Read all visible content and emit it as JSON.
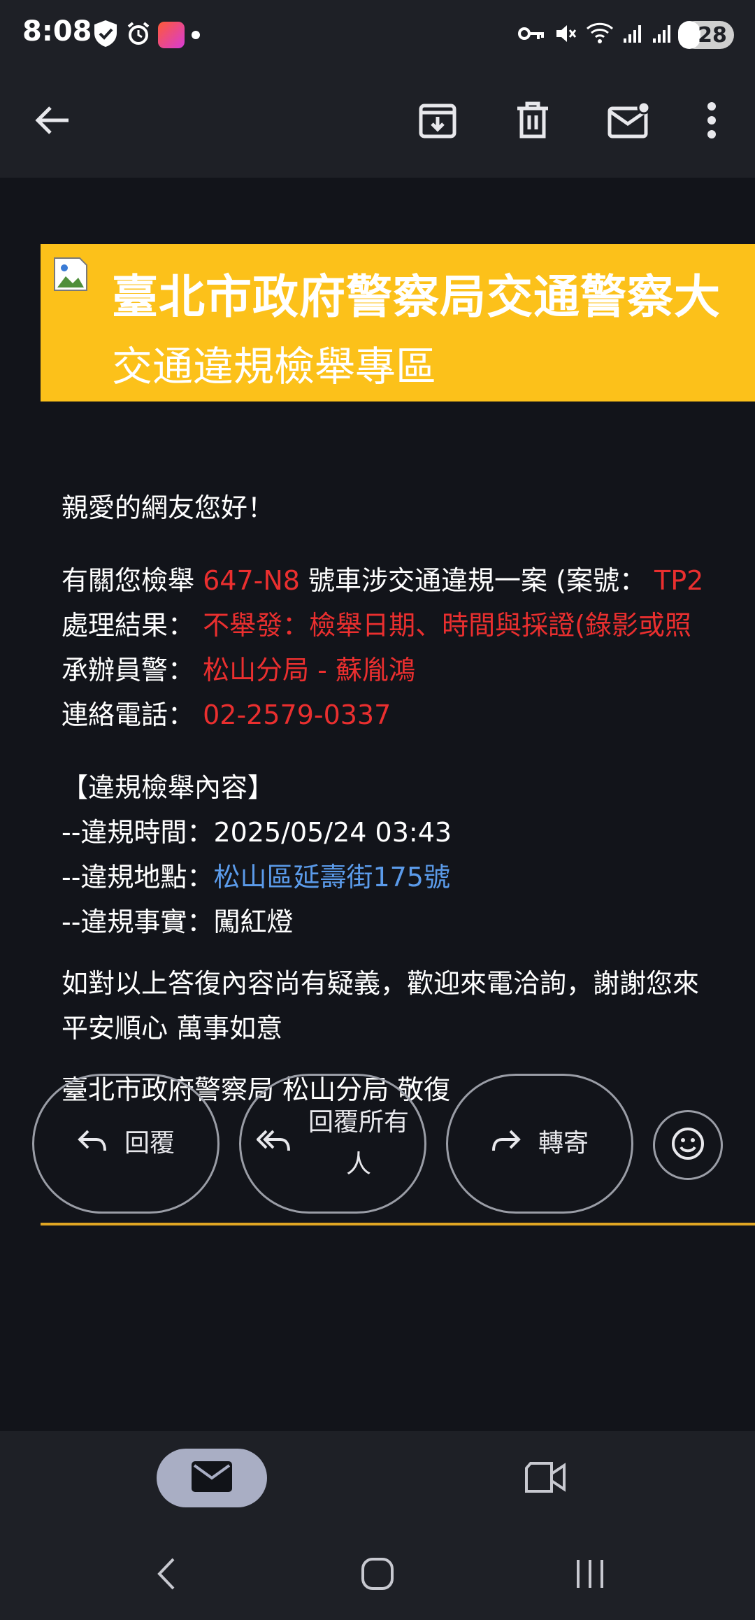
{
  "status_bar": {
    "time": "8:08",
    "battery": "28",
    "icons_left": [
      "shield-check-icon",
      "alarm-icon",
      "app-notification-icon",
      "dot-icon"
    ],
    "icons_right": [
      "vpn-key-icon",
      "mute-icon",
      "wifi-icon",
      "signal-icon",
      "signal-icon",
      "battery-charging-icon"
    ]
  },
  "toolbar": {
    "icons": [
      "back-arrow-icon",
      "archive-icon",
      "delete-icon",
      "mark-unread-icon",
      "more-vert-icon"
    ]
  },
  "email": {
    "banner": {
      "title": "臺北市政府警察局交通警察大",
      "subtitle": "交通違規檢舉專區",
      "background": "#fcc11a"
    },
    "greeting": "親愛的網友您好！",
    "case_line": {
      "prefix": "有關您檢舉 ",
      "plate": "647-N8",
      "middle": " 號車涉交通違規一案 (案號： ",
      "case_no": "TP2"
    },
    "result": {
      "label": "處理結果： ",
      "value": "不舉發：檢舉日期、時間與採證(錄影或照"
    },
    "officer": {
      "label": "承辦員警： ",
      "value": "松山分局 - 蘇胤鴻"
    },
    "phone": {
      "label": "連絡電話： ",
      "value": "02-2579-0337"
    },
    "section_title": "【違規檢舉內容】",
    "violation_time": {
      "label": "--違規時間：",
      "value": "2025/05/24 03:43"
    },
    "violation_place": {
      "label": "--違規地點：",
      "value": "松山區延壽街175號"
    },
    "violation_fact": {
      "label": "--違規事實：",
      "value": "闖紅燈"
    },
    "closing_1": "如對以上答復內容尚有疑義，歡迎來電洽詢，謝謝您來",
    "closing_2": "平安順心 萬事如意",
    "signature": "臺北市政府警察局 松山分局 敬復"
  },
  "actions": {
    "reply": "回覆",
    "reply_all_line1": "回覆所有",
    "reply_all_line2": "人",
    "forward": "轉寄"
  },
  "colors": {
    "accent_red": "#ea2f2f",
    "link_blue": "#5b9bea",
    "divider": "#e0a623"
  }
}
